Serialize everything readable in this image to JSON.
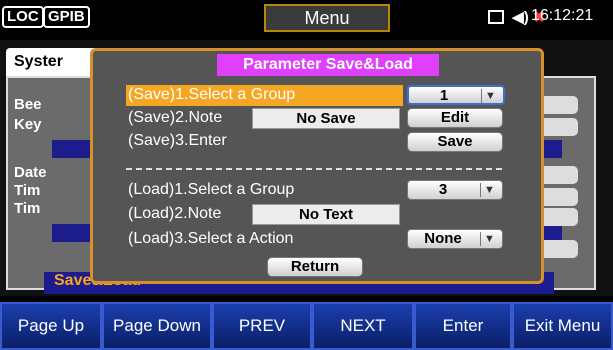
{
  "status_bar": {
    "loc_badge": "LOC",
    "gpib_badge": "GPIB",
    "menu_title": "Menu",
    "time": "16:12:21",
    "icons": [
      "display-icon",
      "speaker-icon",
      "network-disconnected-icon"
    ]
  },
  "background": {
    "tab_system": "Syster",
    "labels": [
      "Bee",
      "Key",
      "Date",
      "Tim",
      "Tim",
      "Save&Load"
    ]
  },
  "dialog": {
    "title": "Parameter Save&Load",
    "save_select_label": "(Save)1.Select a Group",
    "save_select_value": "1",
    "save_note_label": "(Save)2.Note",
    "save_note_value": "No Save",
    "edit_button": "Edit",
    "save_enter_label": "(Save)3.Enter",
    "save_button": "Save",
    "load_select_label": "(Load)1.Select a Group",
    "load_select_value": "3",
    "load_note_label": "(Load)2.Note",
    "load_note_value": "No Text",
    "load_action_label": "(Load)3.Select a Action",
    "load_action_value": "None",
    "return_button": "Return"
  },
  "softkeys": [
    "Page Up",
    "Page Down",
    "PREV",
    "NEXT",
    "Enter",
    "Exit Menu"
  ],
  "colors": {
    "accent_orange": "#f5a623",
    "title_magenta": "#e040fb",
    "softkey_blue": "#1b3fae"
  }
}
